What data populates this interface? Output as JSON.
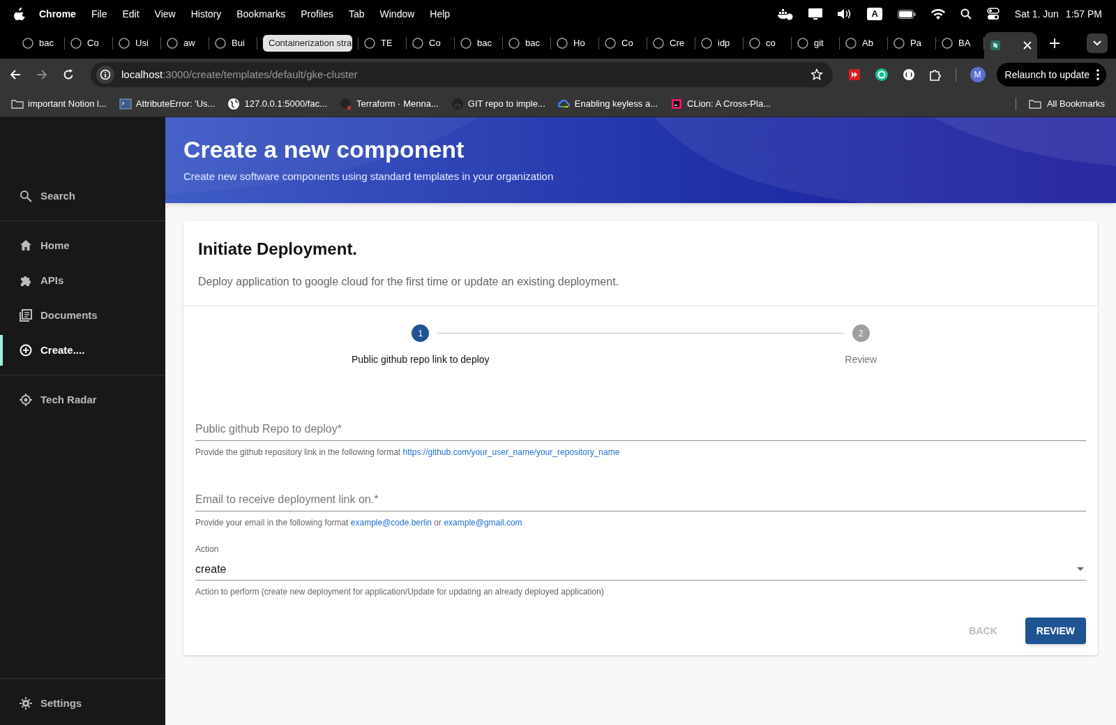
{
  "menu_bar": {
    "app": "Chrome",
    "items": [
      "File",
      "Edit",
      "View",
      "History",
      "Bookmarks",
      "Profiles",
      "Tab",
      "Window",
      "Help"
    ],
    "input_source": "A",
    "date": "Sat 1. Jun",
    "time": "1:57 PM"
  },
  "tabs": [
    {
      "label": "bac",
      "selected": false,
      "highlighted": false
    },
    {
      "label": "Co",
      "selected": false,
      "highlighted": false
    },
    {
      "label": "Usi",
      "selected": false,
      "highlighted": false
    },
    {
      "label": "aw",
      "selected": false,
      "highlighted": false
    },
    {
      "label": "Bui",
      "selected": false,
      "highlighted": false
    },
    {
      "label": "Containerization stra",
      "selected": false,
      "highlighted": true
    },
    {
      "label": "TE",
      "selected": false,
      "highlighted": false
    },
    {
      "label": "Co",
      "selected": false,
      "highlighted": false
    },
    {
      "label": "bac",
      "selected": false,
      "highlighted": false
    },
    {
      "label": "bac",
      "selected": false,
      "highlighted": false
    },
    {
      "label": "Ho",
      "selected": false,
      "highlighted": false
    },
    {
      "label": "Co",
      "selected": false,
      "highlighted": false
    },
    {
      "label": "Cre",
      "selected": false,
      "highlighted": false
    },
    {
      "label": "idp",
      "selected": false,
      "highlighted": false
    },
    {
      "label": "co",
      "selected": false,
      "highlighted": false
    },
    {
      "label": "git",
      "selected": false,
      "highlighted": false
    },
    {
      "label": "Ab",
      "selected": false,
      "highlighted": false
    },
    {
      "label": "Pa",
      "selected": false,
      "highlighted": false
    },
    {
      "label": "BA",
      "selected": false,
      "highlighted": false
    },
    {
      "selected": true,
      "highlighted": false
    }
  ],
  "address_bar": {
    "host": "localhost",
    "path": ":3000/create/templates/default/gke-cluster"
  },
  "profile": {
    "initial": "M"
  },
  "relaunch_button": "Relaunch to update",
  "bookmarks": [
    "important Notion l...",
    "AttributeError: 'Us...",
    "127.0.0.1:5000/fac...",
    "Terraform · Menna...",
    "GIT repo to imple...",
    "Enabling keyless a...",
    "CLion: A Cross-Pla..."
  ],
  "all_bookmarks": "All Bookmarks",
  "sidebar": {
    "search": "Search",
    "items": [
      {
        "label": "Home",
        "selected": false
      },
      {
        "label": "APIs",
        "selected": false
      },
      {
        "label": "Documents",
        "selected": false
      },
      {
        "label": "Create....",
        "selected": true
      }
    ],
    "extra_items": [
      {
        "label": "Tech Radar",
        "selected": false
      }
    ],
    "settings": "Settings"
  },
  "header": {
    "title": "Create a new component",
    "subtitle": "Create new software components using standard templates in your organization"
  },
  "card": {
    "title": "Initiate Deployment.",
    "description": "Deploy application to google cloud for the first time or update an existing deployment.",
    "steps": [
      {
        "number": "1",
        "label": "Public github repo link to deploy",
        "active": true
      },
      {
        "number": "2",
        "label": "Review",
        "active": false
      }
    ],
    "fields": [
      {
        "kind": "text",
        "placeholder": "Public github Repo to deploy*",
        "helper": [
          {
            "text": "Provide the github repository link in the following format "
          },
          {
            "link": "https://github.com/your_user_name/your_repository_name"
          }
        ]
      },
      {
        "kind": "text",
        "placeholder": "Email to receive deployment link on.*",
        "helper": [
          {
            "text": "Provide your email in the following format "
          },
          {
            "link": "example@code.berlin"
          },
          {
            "text": " or "
          },
          {
            "link": "example@gmail.com"
          }
        ]
      },
      {
        "kind": "select",
        "label": "Action",
        "value": "create",
        "helper": [
          {
            "text": "Action to perform (create new deployment for application/Update for updating an already deployed application)"
          }
        ]
      }
    ],
    "buttons": [
      {
        "label": "BACK",
        "disabled": true
      },
      {
        "label": "REVIEW",
        "disabled": false
      }
    ]
  }
}
